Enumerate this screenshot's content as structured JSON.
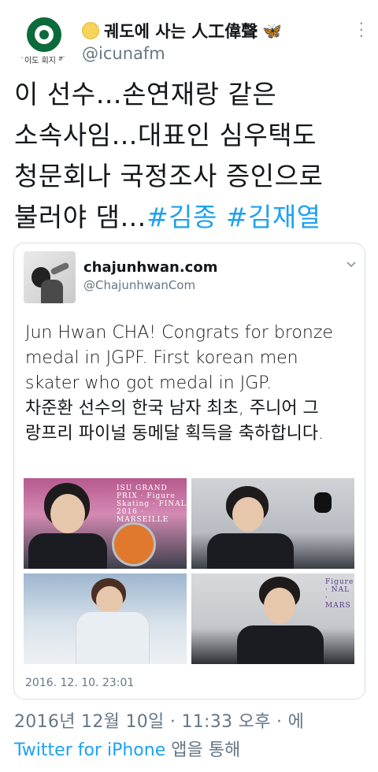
{
  "author": {
    "avatar_caption": "1이도 회지 팡",
    "display_name": "궤도에 사는 人工偉聲",
    "handle": "@icunafm",
    "moon_icon": "moon-emoji-icon",
    "butterfly_icon": "butterfly-emoji-icon"
  },
  "tweet": {
    "line1": "이 선수…손연재랑 같은",
    "line2": "소속사임…대표인 심우택도",
    "line3": "청문회나 국정조사 증인으로",
    "line4_text": "불러야 댐…",
    "hashtags": [
      "#김종",
      "#김재열"
    ],
    "timestamp": "2016년 12월 10일 · 11:33 오후 · 에",
    "source_app": "Twitter for iPhone",
    "source_suffix": " 앱을 통해"
  },
  "quoted": {
    "name": "chajunhwan.com",
    "handle": "@ChajunhwanCom",
    "text_en_1": "Jun Hwan CHA! Congrats for bronze",
    "text_en_2": "medal in JGPF. First korean men",
    "text_en_3": "skater who got medal in JGP.",
    "text_ko_1": "차준환 선수의 한국 남자 최초, 주니어 그",
    "text_ko_2": "랑프리 파이널 동메달 획득을 축하합니다.",
    "date": "2016. 12. 10. 23:01",
    "photo1_banner": "ISU GRAND PRIX · Figure Skating · FINAL 2016 · MARSEILLE",
    "photo4_banner": "Figure · NAL · MARS"
  },
  "colors": {
    "link": "#1da1f2",
    "muted": "#657786",
    "text": "#14171a"
  }
}
